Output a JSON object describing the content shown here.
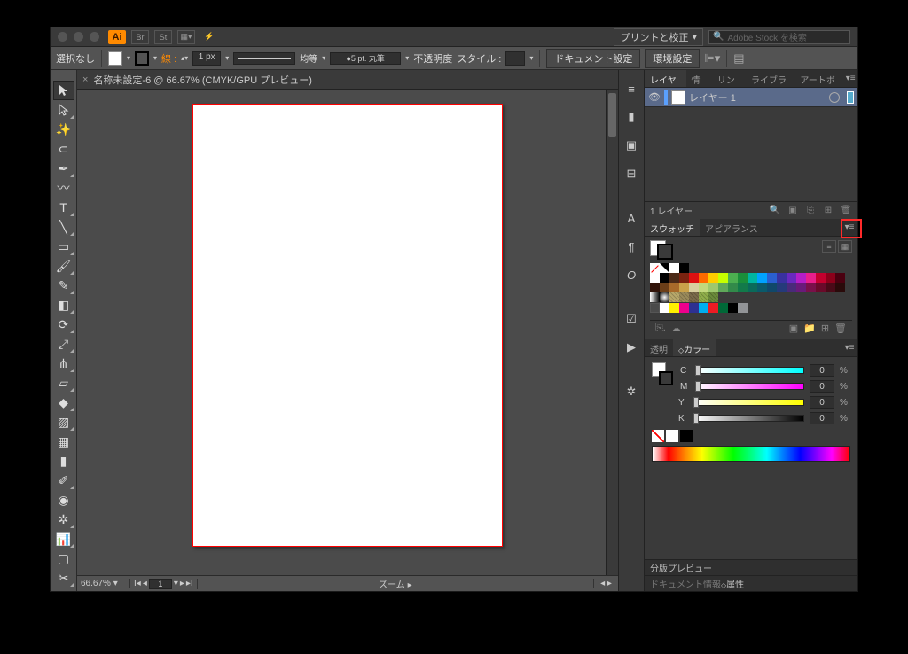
{
  "titlebar": {
    "logo": "Ai",
    "combo_label": "プリントと校正",
    "search_placeholder": "Adobe Stock を検索"
  },
  "controlbar": {
    "selection_label": "選択なし",
    "stroke_label": "線 :",
    "stroke_width": "1 px",
    "profile_label": "均等",
    "brush_label": "5 pt. 丸筆",
    "opacity_label": "不透明度",
    "style_label": "スタイル :",
    "doc_setup_btn": "ドキュメント設定",
    "prefs_btn": "環境設定"
  },
  "doc": {
    "tab_label": "名称未設定-6 @ 66.67% (CMYK/GPU プレビュー)"
  },
  "status": {
    "zoom": "66.67%",
    "page": "1",
    "center": "ズーム"
  },
  "panels": {
    "layers_tabs": [
      "レイヤー",
      "情報",
      "リンク",
      "ライブラリ",
      "アートボー"
    ],
    "layer_name": "レイヤー 1",
    "layers_footer": "1 レイヤー",
    "swatches_tabs": [
      "スウォッチ",
      "アピアランス"
    ],
    "transparency_tabs": [
      "透明",
      "カラー"
    ],
    "color": {
      "c": "0",
      "m": "0",
      "y": "0",
      "k": "0",
      "pct": "%"
    },
    "sep_preview": "分版プレビュー",
    "docinfo_tabs": [
      "ドキュメント情報",
      "属性"
    ]
  },
  "swatches": {
    "row0": [
      "#ffffff",
      "#000000"
    ],
    "row1": [
      "#ffffff",
      "#000000",
      "#4b2a17",
      "#7a2310",
      "#d11",
      "#ff6a00",
      "#ffcc00",
      "#c6ff00",
      "#4caf50",
      "#1a8f3a",
      "#00b5a1",
      "#00a2ff",
      "#2a5fd0",
      "#3931a0",
      "#6a29c0",
      "#b51ec7",
      "#e91e8c",
      "#c4002e",
      "#8c001a",
      "#4a0010"
    ],
    "row2": [
      "#32140a",
      "#6b3e18",
      "#a86a2a",
      "#caa24a",
      "#d8cf9f",
      "#c1d87d",
      "#9ec86e",
      "#5fa85a",
      "#328a4a",
      "#127a4a",
      "#0a6a5a",
      "#0a5a6a",
      "#10486a",
      "#253a7a",
      "#4a2a7a",
      "#6a1a7a",
      "#7a104a",
      "#6a0a2a",
      "#4a0a18",
      "#2a0a0a"
    ],
    "row3_grad": [
      "#ffffff",
      "#000000"
    ],
    "row3_pat": [
      "#b8a86a",
      "#9a8a5a",
      "#7a6a4a",
      "#8fae4a",
      "#6a8a3a"
    ],
    "row4": [
      "#ffffff",
      "#fff100",
      "#ed008c",
      "#2e3192",
      "#00aeef",
      "#ec1c24",
      "#006837",
      "#000000",
      "#929497"
    ]
  }
}
